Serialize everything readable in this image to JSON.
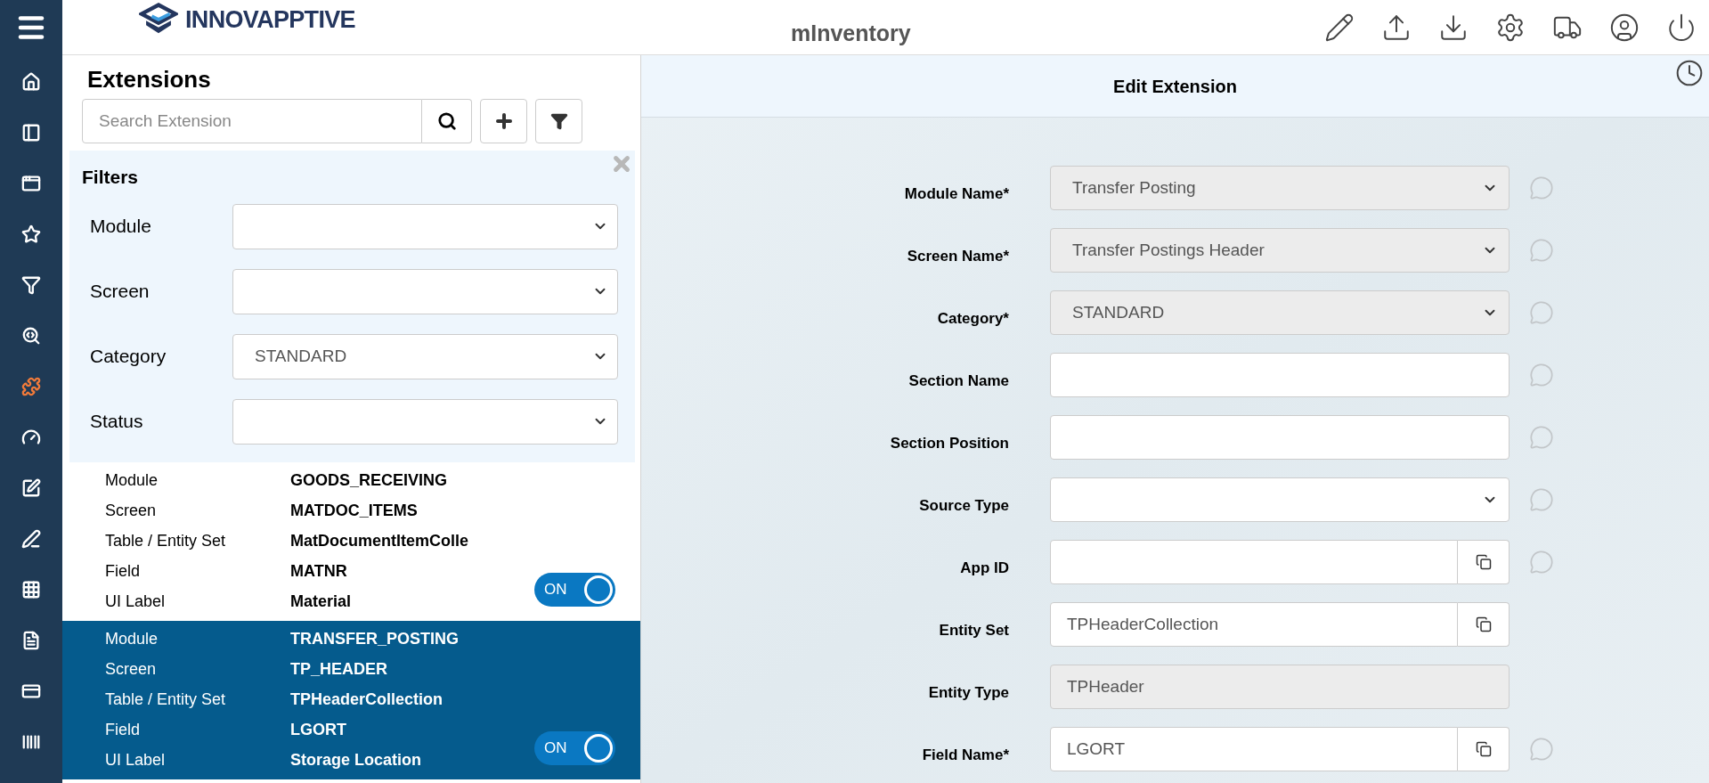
{
  "header": {
    "logo": "INNOVAPPTIVE",
    "title": "mInventory"
  },
  "sidebar": {
    "items": [
      {
        "selected": false
      },
      {
        "selected": false
      },
      {
        "selected": false
      },
      {
        "selected": false
      },
      {
        "selected": false
      },
      {
        "selected": false
      },
      {
        "selected": true
      },
      {
        "selected": false
      },
      {
        "selected": false
      },
      {
        "selected": false
      },
      {
        "selected": false
      },
      {
        "selected": false
      },
      {
        "selected": false
      },
      {
        "selected": false
      }
    ]
  },
  "extensions": {
    "title": "Extensions",
    "search": {
      "placeholder": "Search Extension"
    },
    "filters": {
      "title": "Filters",
      "fields": [
        {
          "label": "Module"
        },
        {
          "label": "Screen"
        },
        {
          "label": "Category",
          "value": "STANDARD"
        },
        {
          "label": "Status"
        }
      ]
    },
    "items": [
      {
        "selected": false,
        "on": true,
        "toggle": "ON",
        "fields": [
          {
            "label": "Module",
            "value": "GOODS_RECEIVING"
          },
          {
            "label": "Screen",
            "value": "MATDOC_ITEMS"
          },
          {
            "label": "Table / Entity Set",
            "value": "MatDocumentItemColle"
          },
          {
            "label": "Field",
            "value": "MATNR"
          },
          {
            "label": "UI Label",
            "value": "Material"
          }
        ]
      },
      {
        "selected": true,
        "on": true,
        "toggle": "ON",
        "fields": [
          {
            "label": "Module",
            "value": "TRANSFER_POSTING"
          },
          {
            "label": "Screen",
            "value": "TP_HEADER"
          },
          {
            "label": "Table / Entity Set",
            "value": "TPHeaderCollection"
          },
          {
            "label": "Field",
            "value": "LGORT"
          },
          {
            "label": "UI Label",
            "value": "Storage Location"
          }
        ]
      }
    ]
  },
  "editor": {
    "title": "Edit Extension",
    "fields": [
      {
        "label": "Module Name*",
        "kind": "select",
        "value": "Transfer Posting",
        "disabled": true,
        "info": true
      },
      {
        "label": "Screen Name*",
        "kind": "select",
        "value": "Transfer Postings Header",
        "disabled": true,
        "info": true
      },
      {
        "label": "Category*",
        "kind": "select",
        "value": "STANDARD",
        "disabled": true,
        "info": true
      },
      {
        "label": "Section Name",
        "kind": "text",
        "disabled": false,
        "info": true
      },
      {
        "label": "Section Position",
        "kind": "text",
        "disabled": false,
        "info": true
      },
      {
        "label": "Source Type",
        "kind": "select",
        "disabled": false,
        "info": true
      },
      {
        "label": "App ID",
        "kind": "copy",
        "disabled": false,
        "info": true
      },
      {
        "label": "Entity Set",
        "kind": "copy",
        "value": "TPHeaderCollection",
        "disabled": false,
        "info": false
      },
      {
        "label": "Entity Type",
        "kind": "text",
        "value": "TPHeader",
        "disabled": true,
        "info": false
      },
      {
        "label": "Field Name*",
        "kind": "copy",
        "value": "LGORT",
        "disabled": false,
        "info": true
      }
    ]
  }
}
